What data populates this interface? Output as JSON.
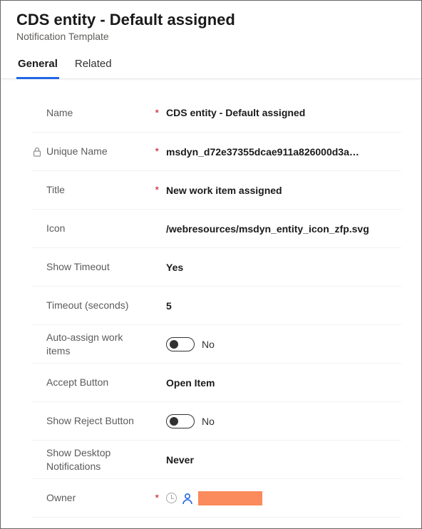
{
  "header": {
    "title": "CDS entity - Default assigned",
    "subtitle": "Notification Template"
  },
  "tabs": {
    "general": "General",
    "related": "Related"
  },
  "fields": {
    "name": {
      "label": "Name",
      "required": "*",
      "value": "CDS entity - Default assigned"
    },
    "unique_name": {
      "label": "Unique Name",
      "required": "*",
      "value": "msdyn_d72e37355dcae911a826000d3a…"
    },
    "title": {
      "label": "Title",
      "required": "*",
      "value": "New work item assigned"
    },
    "icon": {
      "label": "Icon",
      "required": "",
      "value": "/webresources/msdyn_entity_icon_zfp.svg"
    },
    "show_to": {
      "label": "Show Timeout",
      "required": "",
      "value": "Yes"
    },
    "timeout": {
      "label": "Timeout (seconds)",
      "required": "",
      "value": "5"
    },
    "auto": {
      "label": "Auto-assign work items",
      "required": "",
      "value": "No"
    },
    "accept": {
      "label": "Accept Button",
      "required": "",
      "value": "Open Item"
    },
    "reject": {
      "label": "Show Reject Button",
      "required": "",
      "value": "No"
    },
    "desktop": {
      "label": "Show Desktop Notifications",
      "required": "",
      "value": "Never"
    },
    "owner": {
      "label": "Owner",
      "required": "*",
      "value": ""
    }
  }
}
